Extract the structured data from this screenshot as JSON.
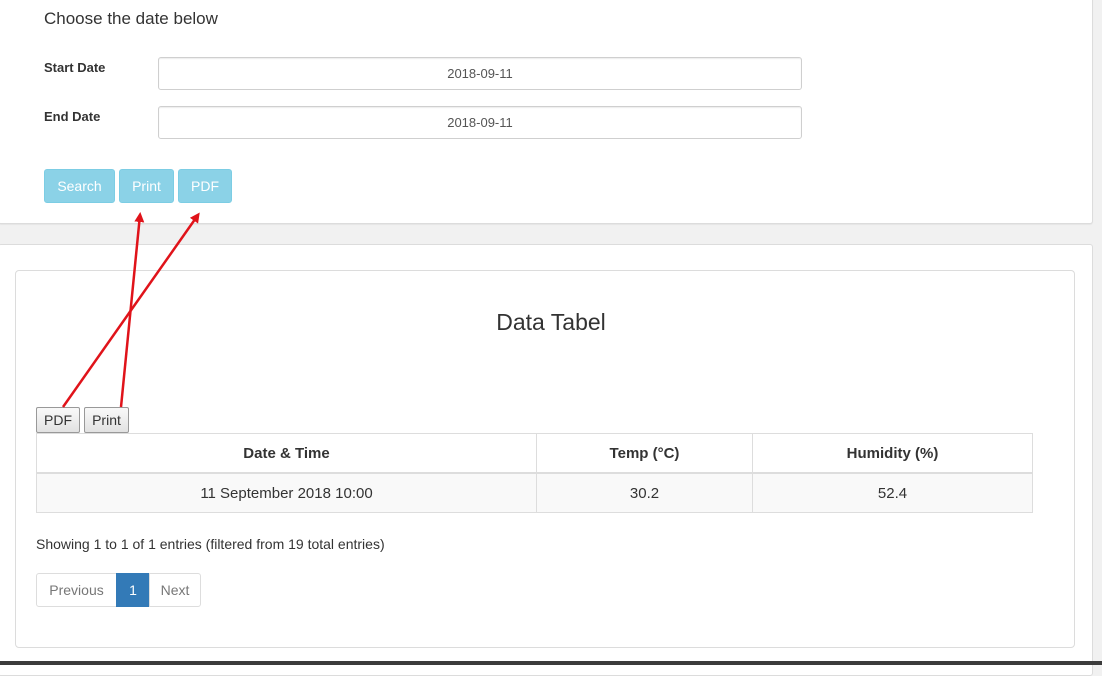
{
  "form": {
    "heading": "Choose the date below",
    "start_label": "Start Date",
    "start_value": "2018-09-11",
    "end_label": "End Date",
    "end_value": "2018-09-11",
    "buttons": {
      "search": "Search",
      "print": "Print",
      "pdf": "PDF"
    },
    "button_color": "#5bc0de"
  },
  "table_section": {
    "title": "Data Tabel",
    "export_buttons": {
      "pdf": "PDF",
      "print": "Print"
    },
    "columns": [
      "Date & Time",
      "Temp (°C)",
      "Humidity (%)"
    ],
    "rows": [
      [
        "11 September 2018 10:00",
        "30.2",
        "52.4"
      ]
    ],
    "info": "Showing 1 to 1 of 1 entries (filtered from 19 total entries)",
    "pagination": {
      "previous": "Previous",
      "current_page": "1",
      "next": "Next"
    },
    "active_page_color": "#337ab7"
  },
  "annotation": {
    "arrow_color": "#e0131a"
  }
}
